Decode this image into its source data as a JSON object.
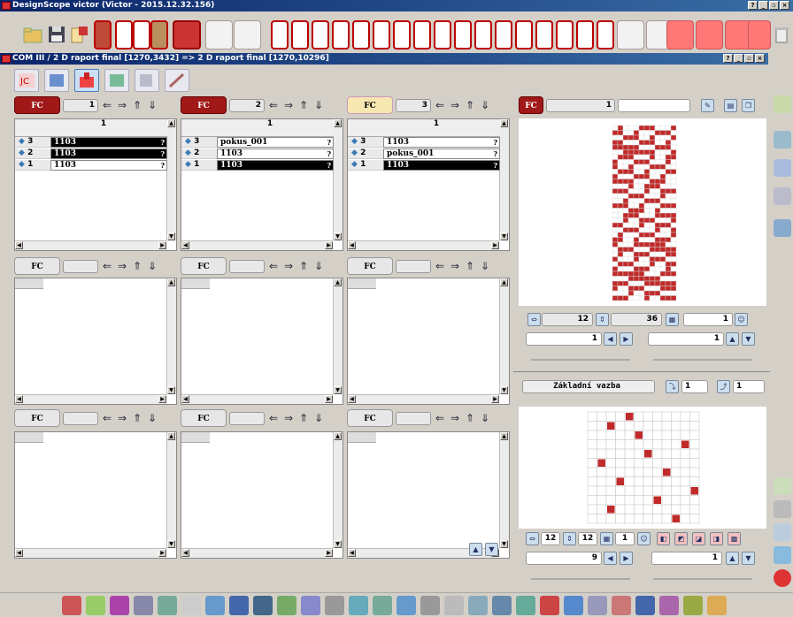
{
  "app": {
    "title": "DesignScope victor (Victor - 2015.12.32.156)"
  },
  "subwindow": {
    "title": "COM III  / 2 D raport final [1270,3432] => 2 D raport final [1270,10296]"
  },
  "panels_row1": [
    {
      "fc": "FC",
      "fc_style": "red",
      "num": "1",
      "col": "1",
      "rows": [
        {
          "n": "3",
          "v": "1103",
          "dark": true,
          "q": "?"
        },
        {
          "n": "2",
          "v": "1103",
          "dark": true,
          "q": "?"
        },
        {
          "n": "1",
          "v": "1103",
          "dark": false,
          "q": "?"
        }
      ]
    },
    {
      "fc": "FC",
      "fc_style": "red",
      "num": "2",
      "col": "1",
      "rows": [
        {
          "n": "3",
          "v": "pokus_001",
          "dark": false,
          "q": "?"
        },
        {
          "n": "2",
          "v": "1103",
          "dark": false,
          "q": "?"
        },
        {
          "n": "1",
          "v": "1103",
          "dark": true,
          "q": "?"
        }
      ]
    },
    {
      "fc": "FC",
      "fc_style": "cream",
      "num": "3",
      "col": "1",
      "rows": [
        {
          "n": "3",
          "v": "1103",
          "dark": false,
          "q": "?"
        },
        {
          "n": "2",
          "v": "pokus_001",
          "dark": false,
          "q": "?"
        },
        {
          "n": "1",
          "v": "1103",
          "dark": true,
          "q": "?"
        }
      ]
    }
  ],
  "panels_row2": [
    {
      "fc": "FC"
    },
    {
      "fc": "FC"
    },
    {
      "fc": "FC"
    }
  ],
  "panels_row3": [
    {
      "fc": "FC"
    },
    {
      "fc": "FC"
    },
    {
      "fc": "FC"
    }
  ],
  "right": {
    "fc": "FC",
    "num": "1",
    "repeat_x": "12",
    "repeat_y": "36",
    "field_a": "1",
    "field_b": "1",
    "field_c": "1",
    "weave_label": "Základní vazba",
    "weave_f1": "1",
    "weave_f2": "1",
    "w_x": "12",
    "w_y": "12",
    "w_n": "1",
    "w_field_a": "9",
    "w_field_b": "1"
  },
  "colors": {
    "accent_red": "#b01c1c",
    "titlebar": "#0a246a",
    "pattern_red": "#c02a2a"
  },
  "icons": {
    "nav": [
      "arrow-left-icon",
      "arrow-right-icon",
      "arrow-up-icon",
      "arrow-down-icon"
    ]
  }
}
